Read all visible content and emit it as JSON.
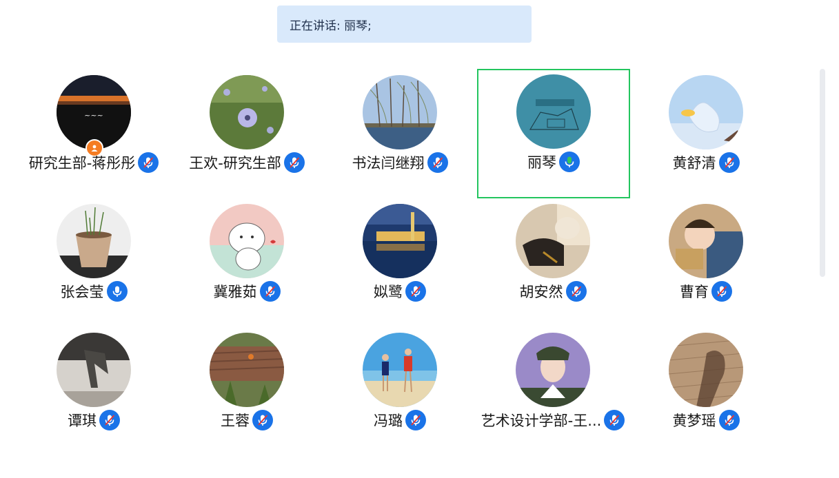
{
  "speaking": {
    "label": "正在讲话: 丽琴;"
  },
  "participants": [
    {
      "name": "研究生部-蒋彤彤",
      "mic": "muted",
      "host": true,
      "active": false
    },
    {
      "name": "王欢-研究生部",
      "mic": "muted",
      "host": false,
      "active": false
    },
    {
      "name": "书法闫继翔",
      "mic": "muted",
      "host": false,
      "active": false
    },
    {
      "name": "丽琴",
      "mic": "speaking",
      "host": false,
      "active": true
    },
    {
      "name": "黄舒清",
      "mic": "muted",
      "host": false,
      "active": false
    },
    {
      "name": "张会莹",
      "mic": "on",
      "host": false,
      "active": false
    },
    {
      "name": "冀雅茹",
      "mic": "muted",
      "host": false,
      "active": false
    },
    {
      "name": "姒鹭",
      "mic": "muted",
      "host": false,
      "active": false
    },
    {
      "name": "胡安然",
      "mic": "muted",
      "host": false,
      "active": false
    },
    {
      "name": "曹育",
      "mic": "muted",
      "host": false,
      "active": false
    },
    {
      "name": "谭琪",
      "mic": "muted",
      "host": false,
      "active": false
    },
    {
      "name": "王蓉",
      "mic": "muted",
      "host": false,
      "active": false
    },
    {
      "name": "冯璐",
      "mic": "muted",
      "host": false,
      "active": false
    },
    {
      "name": "艺术设计学部-王...",
      "mic": "muted",
      "host": false,
      "active": false
    },
    {
      "name": "黄梦瑶",
      "mic": "muted",
      "host": false,
      "active": false
    }
  ],
  "avatar_images": {
    "0": "night-sky-calligraphy-photo",
    "1": "blue-flower-photo",
    "2": "willow-lake-photo",
    "3": "book-cover-photo",
    "4": "sky-swan-illustration",
    "5": "potted-seedlings-photo",
    "6": "cartoon-cat-illustration",
    "7": "mosque-reflection-photo",
    "8": "dog-and-person-photo",
    "9": "baby-photo",
    "10": "shadow-wall-photo",
    "11": "plants-wood-photo",
    "12": "kids-on-beach-photo",
    "13": "portrait-illustration",
    "14": "shadow-brick-photo"
  },
  "colors": {
    "banner_bg": "#d9e9fb",
    "mic_blue": "#1a73e8",
    "mic_speaking": "#34c759",
    "mute_slash": "#e53935",
    "active_border": "#22c55e",
    "host_badge": "#f57c22"
  }
}
